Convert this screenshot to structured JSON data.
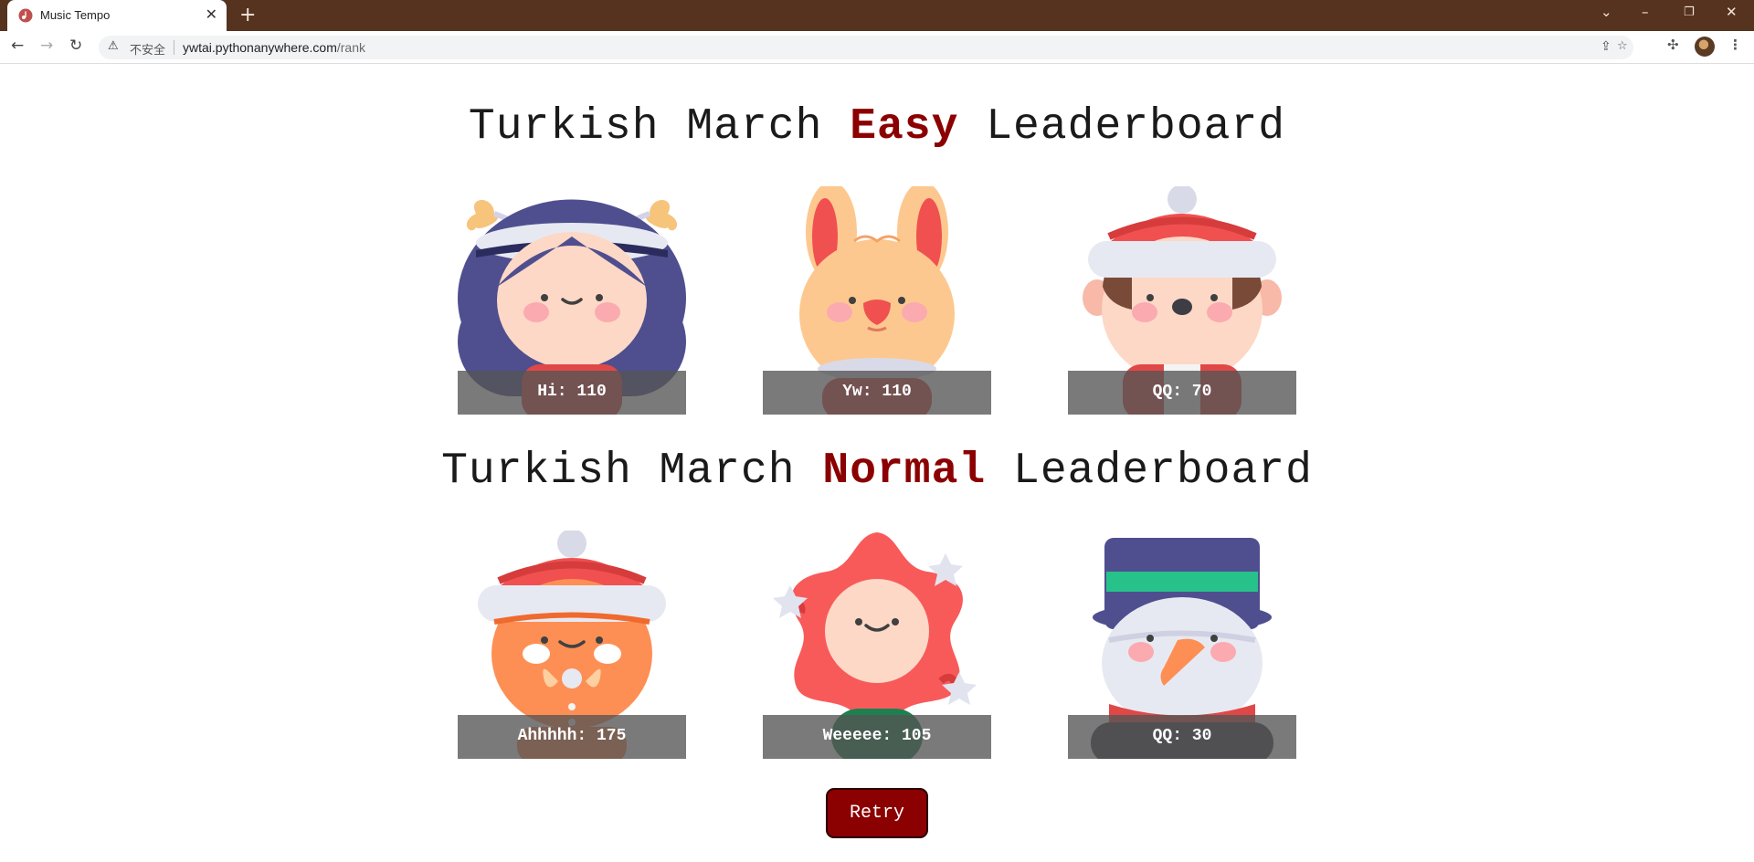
{
  "browser": {
    "tab_title": "Music Tempo",
    "security_label": "不安全",
    "url_host": "ywtai.pythonanywhere.com",
    "url_path": "/rank"
  },
  "easy": {
    "title_prefix": "Turkish March",
    "level": "Easy",
    "title_suffix": "Leaderboard",
    "entries": [
      {
        "label": "Hi: 110",
        "avatar": "girl-with-star-headband"
      },
      {
        "label": "Yw: 110",
        "avatar": "bunny"
      },
      {
        "label": "QQ: 70",
        "avatar": "kid-with-red-beanie"
      }
    ]
  },
  "normal": {
    "title_prefix": "Turkish March",
    "level": "Normal",
    "title_suffix": "Leaderboard",
    "entries": [
      {
        "label": "Ahhhhh: 175",
        "avatar": "gingerbread-man"
      },
      {
        "label": "Weeeee: 105",
        "avatar": "poinsettia-flower"
      },
      {
        "label": "QQ: 30",
        "avatar": "snowman-with-top-hat"
      }
    ]
  },
  "retry_label": "Retry",
  "colors": {
    "accent": "#8b0000",
    "chrome": "#56331e"
  }
}
